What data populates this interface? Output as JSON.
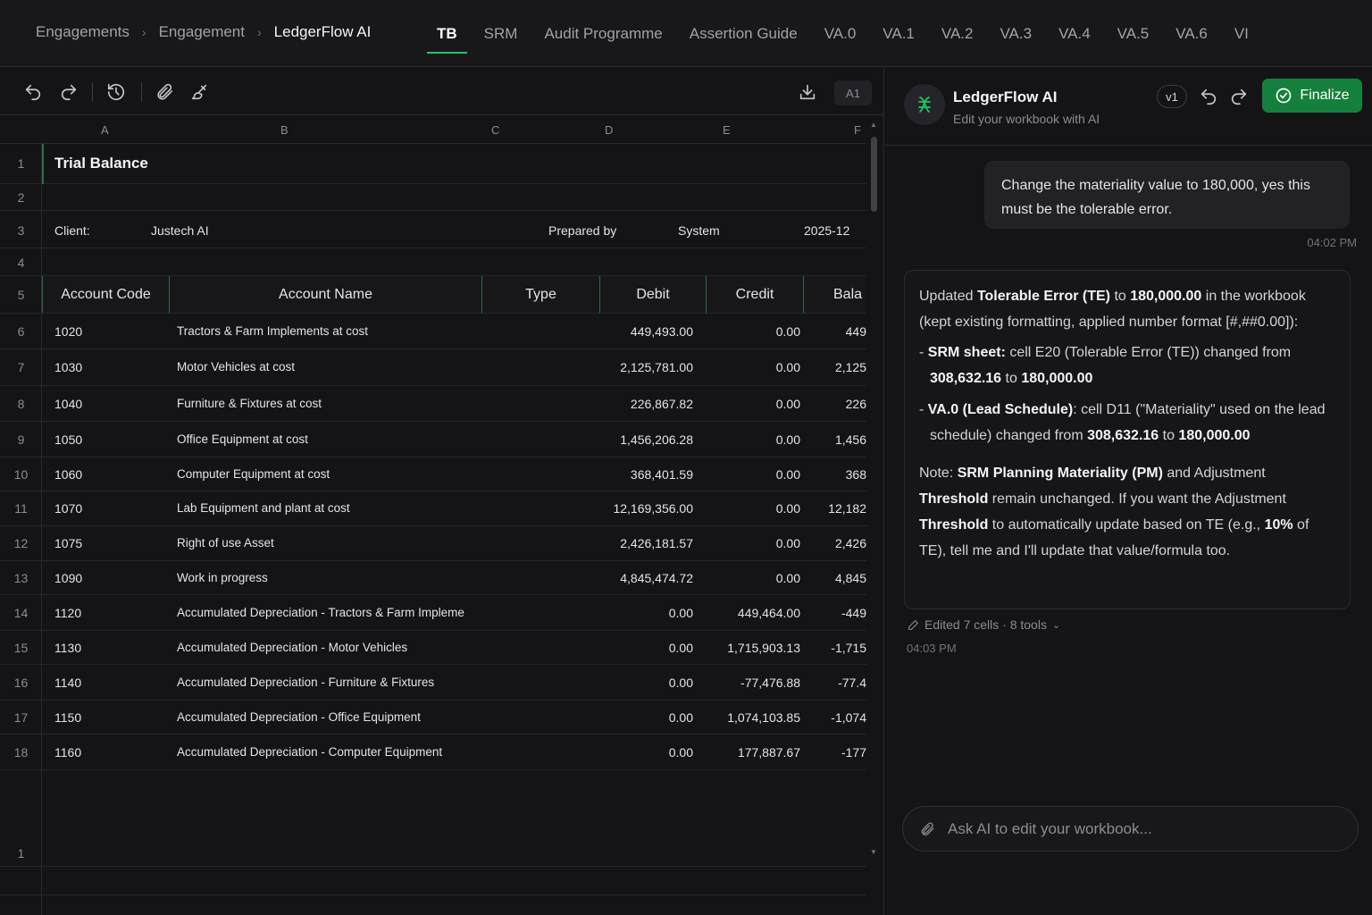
{
  "breadcrumb": [
    "Engagements",
    "Engagement",
    "LedgerFlow AI"
  ],
  "tabs": [
    "TB",
    "SRM",
    "Audit Programme",
    "Assertion Guide",
    "VA.0",
    "VA.1",
    "VA.2",
    "VA.3",
    "VA.4",
    "VA.5",
    "VA.6",
    "VI"
  ],
  "active_tab": "TB",
  "toolbar": {
    "cell_ref": "A1",
    "icons": [
      "undo-icon",
      "redo-icon",
      "history-icon",
      "paperclip-icon",
      "brush-icon",
      "download-icon"
    ]
  },
  "sheet": {
    "columns": [
      "A",
      "B",
      "C",
      "D",
      "E",
      "F"
    ],
    "title": "Trial Balance",
    "client_label": "Client:",
    "client_value": "Justech AI",
    "prepared_label": "Prepared by",
    "prepared_value": "System",
    "period": "2025-12",
    "headers": [
      "Account Code",
      "Account Name",
      "Type",
      "Debit",
      "Credit",
      "Bala"
    ],
    "rows": [
      {
        "n": "6",
        "code": "1020",
        "name": "Tractors & Farm Implements at cost",
        "debit": "449,493.00",
        "credit": "0.00",
        "bal": "449"
      },
      {
        "n": "7",
        "code": "1030",
        "name": "Motor Vehicles at cost",
        "debit": "2,125,781.00",
        "credit": "0.00",
        "bal": "2,125"
      },
      {
        "n": "8",
        "code": "1040",
        "name": "Furniture & Fixtures at cost",
        "debit": "226,867.82",
        "credit": "0.00",
        "bal": "226"
      },
      {
        "n": "9",
        "code": "1050",
        "name": "Office Equipment at cost",
        "debit": "1,456,206.28",
        "credit": "0.00",
        "bal": "1,456"
      },
      {
        "n": "10",
        "code": "1060",
        "name": "Computer Equipment at cost",
        "debit": "368,401.59",
        "credit": "0.00",
        "bal": "368"
      },
      {
        "n": "11",
        "code": "1070",
        "name": "Lab Equipment and plant at cost",
        "debit": "12,169,356.00",
        "credit": "0.00",
        "bal": "12,182"
      },
      {
        "n": "12",
        "code": "1075",
        "name": "Right of use Asset",
        "debit": "2,426,181.57",
        "credit": "0.00",
        "bal": "2,426"
      },
      {
        "n": "13",
        "code": "1090",
        "name": "Work in progress",
        "debit": "4,845,474.72",
        "credit": "0.00",
        "bal": "4,845"
      },
      {
        "n": "14",
        "code": "1120",
        "name": "Accumulated Depreciation  -  Tractors & Farm Impleme",
        "debit": "0.00",
        "credit": "449,464.00",
        "bal": "-449"
      },
      {
        "n": "15",
        "code": "1130",
        "name": "Accumulated Depreciation  -  Motor Vehicles",
        "debit": "0.00",
        "credit": "1,715,903.13",
        "bal": "-1,715"
      },
      {
        "n": "16",
        "code": "1140",
        "name": "Accumulated Depreciation  -  Furniture & Fixtures",
        "debit": "0.00",
        "credit": "-77,476.88",
        "bal": "-77.4"
      },
      {
        "n": "17",
        "code": "1150",
        "name": "Accumulated Depreciation  -  Office Equipment",
        "debit": "0.00",
        "credit": "1,074,103.85",
        "bal": "-1,074"
      },
      {
        "n": "18",
        "code": "1160",
        "name": "Accumulated Depreciation  -  Computer Equipment",
        "debit": "0.00",
        "credit": "177,887.67",
        "bal": "-177"
      }
    ],
    "trailing_row_number": "1"
  },
  "assistant": {
    "name": "LedgerFlow AI",
    "subtitle": "Edit your workbook with AI",
    "version": "v1",
    "finalize_label": "Finalize",
    "user_message": "Change the materiality value to 180,000, yes this must be the tolerable error.",
    "user_time": "04:02 PM",
    "reply": {
      "p1_a": "Updated ",
      "p1_b": "Tolerable Error (TE)",
      "p1_c": " to ",
      "p1_d": "180,000.00",
      "p1_e": " in the workbook (kept existing formatting, applied number format [#,##0.00]):",
      "b1_a": "- ",
      "b1_b": "SRM sheet:",
      "b1_c": " cell E20 (Tolerable Error (TE)) changed from ",
      "b1_d": "308,632.16",
      "b1_e": " to ",
      "b1_f": "180,000.00",
      "b2_a": "- ",
      "b2_b": "VA.0 (Lead Schedule)",
      "b2_c": ": cell D11 (\"Materiality\" used on the lead schedule) changed from ",
      "b2_d": "308,632.16",
      "b2_e": " to ",
      "b2_f": "180,000.00",
      "n_a": "Note: ",
      "n_b": "SRM Planning Materiality (PM)",
      "n_c": " and Adjustment ",
      "n_d": "Threshold",
      "n_e": " remain unchanged. If you want the Adjustment ",
      "n_f": "Threshold",
      "n_g": " to automatically update based on TE (e.g., ",
      "n_h": "10%",
      "n_i": " of TE), tell me and I'll update that value/formula too."
    },
    "edited_summary": "Edited 7 cells · 8 tools",
    "reply_time": "04:03 PM",
    "input_placeholder": "Ask AI to edit your workbook..."
  },
  "colors": {
    "accent": "#22c55e",
    "finalize_bg": "#15803d",
    "background": "#141417"
  }
}
